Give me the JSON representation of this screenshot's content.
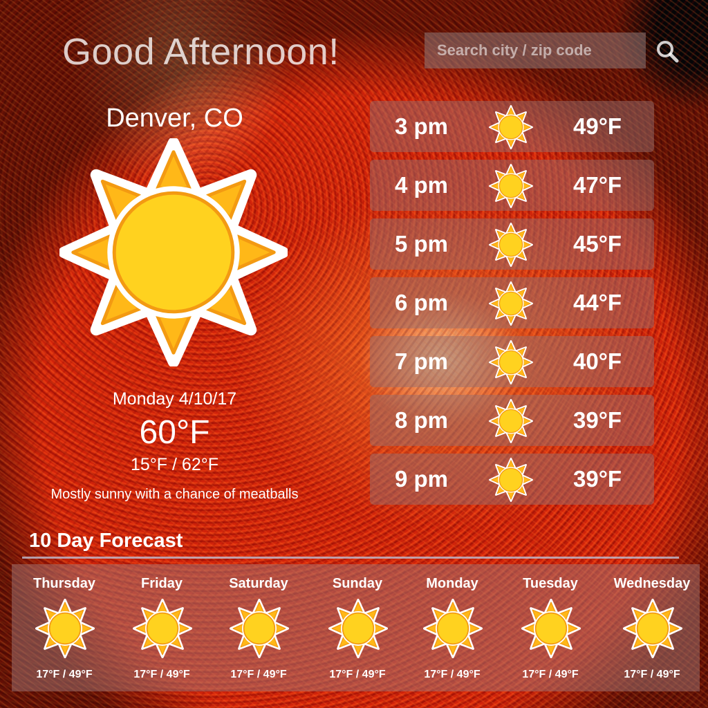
{
  "header": {
    "greeting": "Good Afternoon!",
    "search_placeholder": "Search city / zip code",
    "search_icon": "search-icon"
  },
  "current": {
    "city": "Denver, CO",
    "icon": "sun-icon",
    "date": "Monday 4/10/17",
    "temp": "60°F",
    "range": "15°F / 62°F",
    "description": "Mostly sunny with a chance of meatballs"
  },
  "hourly": [
    {
      "time": "3 pm",
      "temp": "49°F",
      "icon": "sun-icon"
    },
    {
      "time": "4 pm",
      "temp": "47°F",
      "icon": "sun-icon"
    },
    {
      "time": "5 pm",
      "temp": "45°F",
      "icon": "sun-icon"
    },
    {
      "time": "6 pm",
      "temp": "44°F",
      "icon": "sun-icon"
    },
    {
      "time": "7 pm",
      "temp": "40°F",
      "icon": "sun-icon"
    },
    {
      "time": "8 pm",
      "temp": "39°F",
      "icon": "sun-icon"
    },
    {
      "time": "9 pm",
      "temp": "39°F",
      "icon": "sun-icon"
    }
  ],
  "forecast": {
    "title": "10 Day Forecast",
    "days": [
      {
        "day": "Thursday",
        "range": "17°F / 49°F",
        "icon": "sun-icon"
      },
      {
        "day": "Friday",
        "range": "17°F / 49°F",
        "icon": "sun-icon"
      },
      {
        "day": "Saturday",
        "range": "17°F / 49°F",
        "icon": "sun-icon"
      },
      {
        "day": "Sunday",
        "range": "17°F / 49°F",
        "icon": "sun-icon"
      },
      {
        "day": "Monday",
        "range": "17°F / 49°F",
        "icon": "sun-icon"
      },
      {
        "day": "Tuesday",
        "range": "17°F / 49°F",
        "icon": "sun-icon"
      },
      {
        "day": "Wednesday",
        "range": "17°F / 49°F",
        "icon": "sun-icon"
      }
    ]
  },
  "colors": {
    "sun_core": "#FFD21F",
    "sun_ray": "#FFB818",
    "sun_outline": "#F39A12",
    "panel": "#966E6E"
  }
}
